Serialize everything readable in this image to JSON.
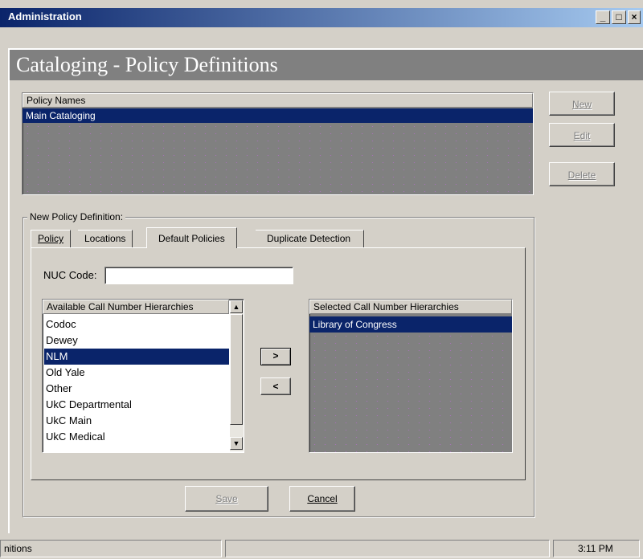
{
  "window": {
    "title": "Administration",
    "minimize_icon": "minimize-icon",
    "maximize_icon": "maximize-icon",
    "close_icon": "close-icon"
  },
  "header": {
    "title": "Cataloging - Policy Definitions"
  },
  "policy_list": {
    "column": "Policy Names",
    "items": [
      "Main Cataloging"
    ],
    "selected": "Main Cataloging"
  },
  "side_buttons": {
    "new": "New",
    "edit": "Edit",
    "delete": "Delete"
  },
  "group": {
    "label": "New  Policy Definition:"
  },
  "tabs": [
    {
      "label": "Policy"
    },
    {
      "label": "Locations"
    },
    {
      "label": "Default Policies",
      "active": true
    },
    {
      "label": "Duplicate Detection"
    }
  ],
  "nuc": {
    "label": "NUC Code:",
    "value": ""
  },
  "available": {
    "column": "Available Call Number Hierarchies",
    "items": [
      "Codoc",
      "Dewey",
      "NLM",
      "Old Yale",
      "Other",
      "UkC Departmental",
      "UkC Main",
      "UkC Medical"
    ],
    "selected": "NLM"
  },
  "move_buttons": {
    "add": ">",
    "remove": "<"
  },
  "selected_list": {
    "column": "Selected Call Number Hierarchies",
    "items": [
      "Library of Congress"
    ]
  },
  "footer_buttons": {
    "save": "Save",
    "cancel": "Cancel"
  },
  "statusbar": {
    "left": "nitions",
    "middle": "",
    "time": "3:11 PM"
  },
  "colors": {
    "selection": "#0a246a",
    "face": "#d4d0c8",
    "dark": "#808080"
  }
}
